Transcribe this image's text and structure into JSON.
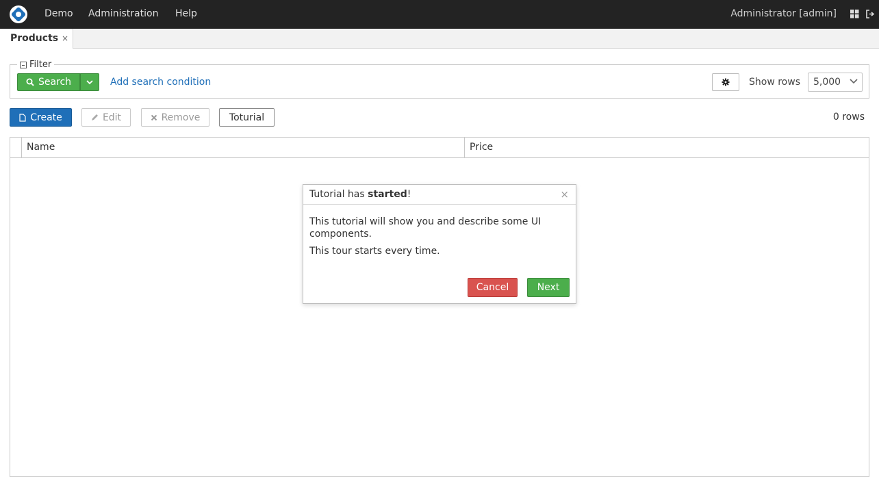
{
  "topbar": {
    "menu": [
      "Demo",
      "Administration",
      "Help"
    ],
    "user": "Administrator [admin]"
  },
  "tabs": [
    {
      "label": "Products",
      "close": "×"
    }
  ],
  "filter": {
    "legend": "Filter",
    "search_label": "Search",
    "add_condition": "Add search condition",
    "show_rows_label": "Show rows",
    "show_rows_value": "5,000"
  },
  "toolbar": {
    "create": "Create",
    "edit": "Edit",
    "remove": "Remove",
    "tutorial": "Toturial",
    "rows_count": "0 rows"
  },
  "grid": {
    "columns": [
      "Name",
      "Price"
    ]
  },
  "popover": {
    "title_prefix": "Tutorial has ",
    "title_bold": "started",
    "title_suffix": "!",
    "close": "×",
    "body1": "This tutorial will show you and describe some UI components.",
    "body2": "This tour starts every time.",
    "cancel": "Cancel",
    "next": "Next"
  },
  "colors": {
    "topbar": "#232323",
    "primary": "#1f6fb8",
    "success": "#4cae4c",
    "danger": "#d9534f"
  }
}
